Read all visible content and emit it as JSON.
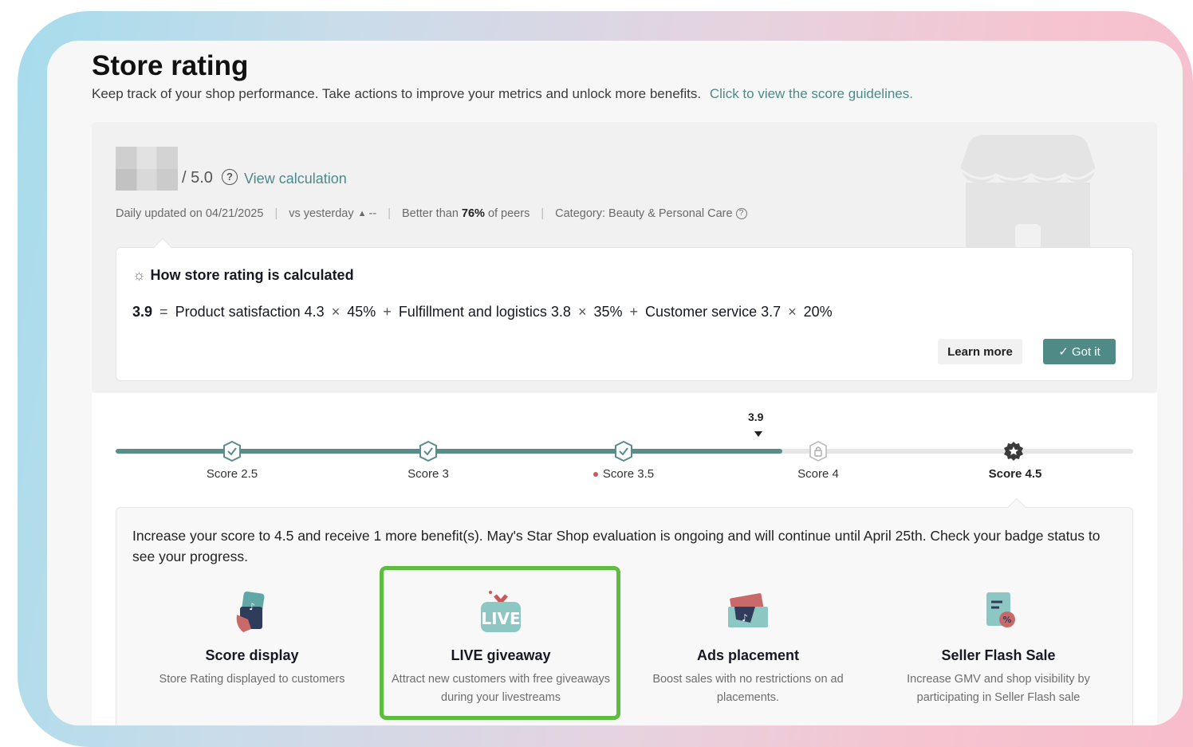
{
  "header": {
    "title": "Store rating",
    "subtitle": "Keep track of your shop performance. Take actions to improve your metrics and unlock more benefits.",
    "guidelines_link": "Click to view the score guidelines."
  },
  "score": {
    "max": "/ 5.0",
    "view_calculation": "View calculation"
  },
  "meta": {
    "updated": "Daily updated on 04/21/2025",
    "vs_yesterday": "vs yesterday",
    "vs_value": "--",
    "better_prefix": "Better than",
    "better_value": "76%",
    "better_suffix": "of peers",
    "category": "Category: Beauty & Personal Care"
  },
  "calculation": {
    "title": "How store rating is calculated",
    "result": "3.9",
    "eq": "=",
    "terms": [
      {
        "label": "Product satisfaction 4.3",
        "weight": "45%"
      },
      {
        "label": "Fulfillment and logistics 3.8",
        "weight": "35%"
      },
      {
        "label": "Customer service 3.7",
        "weight": "20%"
      }
    ],
    "times": "×",
    "plus": "+",
    "learn_more": "Learn more",
    "got_it": "Got it",
    "check": "✓"
  },
  "progress": {
    "current_value": "3.9",
    "current_score": 3.9,
    "milestones": [
      {
        "label": "Score 2.5",
        "state": "done"
      },
      {
        "label": "Score 3",
        "state": "done"
      },
      {
        "label": "Score 3.5",
        "state": "done",
        "dot": true
      },
      {
        "label": "Score 4",
        "state": "locked"
      },
      {
        "label": "Score 4.5",
        "state": "star",
        "selected": true
      }
    ],
    "fill_color": "#5a8d8a"
  },
  "benefits": {
    "intro": "Increase your score to 4.5 and receive 1 more benefit(s). May's Star Shop evaluation is ongoing and will continue until April 25th. Check your badge status to see your progress.",
    "items": [
      {
        "title": "Score display",
        "desc": "Store Rating displayed to customers",
        "icon": "phone-tiktok-icon"
      },
      {
        "title": "LIVE giveaway",
        "desc": "Attract new customers with free giveaways during your livestreams",
        "icon": "live-tv-icon",
        "icon_text": "LIVE"
      },
      {
        "title": "Ads placement",
        "desc": "Boost sales with no restrictions on ad placements.",
        "icon": "ad-ticket-icon"
      },
      {
        "title": "Seller Flash Sale",
        "desc": "Increase GMV and shop visibility by participating in Seller Flash sale",
        "icon": "flash-sale-doc-icon"
      }
    ]
  },
  "colors": {
    "accent": "#4f8a87",
    "highlight": "#5dbd3f",
    "link": "#4c8a88"
  }
}
